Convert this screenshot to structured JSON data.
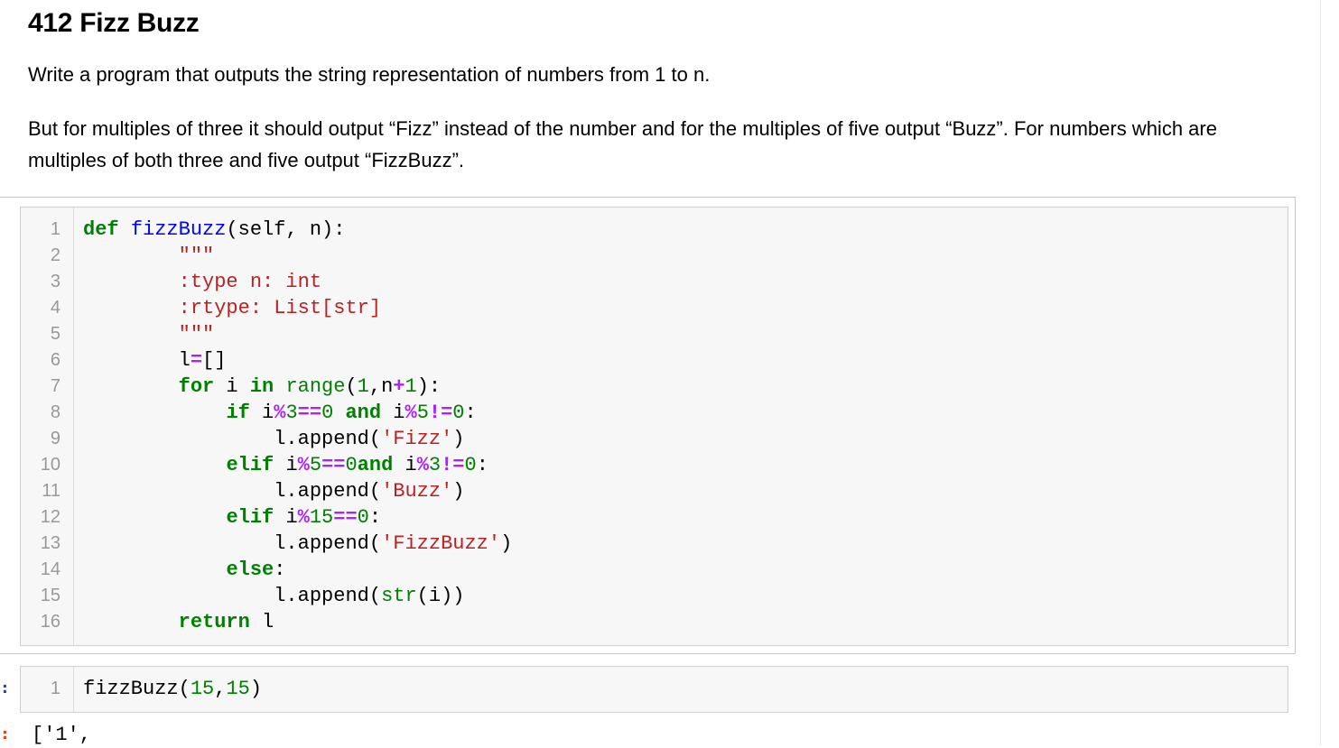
{
  "markdown": {
    "heading": "412 Fizz Buzz",
    "paragraph1": "Write a program that outputs the string representation of numbers from 1 to n.",
    "paragraph2": "But for multiples of three it should output “Fizz” instead of the number and for the multiples of five output “Buzz”. For numbers which are multiples of both three and five output “FizzBuzz”."
  },
  "prompts": {
    "cell1": ":",
    "cell2": ":",
    "output": ":"
  },
  "cell1": {
    "line_numbers": [
      "1",
      "2",
      "3",
      "4",
      "5",
      "6",
      "7",
      "8",
      "9",
      "10",
      "11",
      "12",
      "13",
      "14",
      "15",
      "16"
    ],
    "lines": [
      [
        {
          "t": "def ",
          "c": "kw"
        },
        {
          "t": "fizzBuzz",
          "c": "fn"
        },
        {
          "t": "(self, n):",
          "c": ""
        }
      ],
      [
        {
          "t": "        \"\"\"",
          "c": "str"
        }
      ],
      [
        {
          "t": "        :type n: int",
          "c": "str"
        }
      ],
      [
        {
          "t": "        :rtype: List[str]",
          "c": "str"
        }
      ],
      [
        {
          "t": "        \"\"\"",
          "c": "str"
        }
      ],
      [
        {
          "t": "        l",
          "c": ""
        },
        {
          "t": "=",
          "c": "op"
        },
        {
          "t": "[]",
          "c": ""
        }
      ],
      [
        {
          "t": "        ",
          "c": ""
        },
        {
          "t": "for",
          "c": "kw"
        },
        {
          "t": " i ",
          "c": ""
        },
        {
          "t": "in",
          "c": "kw"
        },
        {
          "t": " ",
          "c": ""
        },
        {
          "t": "range",
          "c": "bi"
        },
        {
          "t": "(",
          "c": ""
        },
        {
          "t": "1",
          "c": "num"
        },
        {
          "t": ",n",
          "c": ""
        },
        {
          "t": "+",
          "c": "op"
        },
        {
          "t": "1",
          "c": "num"
        },
        {
          "t": "):",
          "c": ""
        }
      ],
      [
        {
          "t": "            ",
          "c": ""
        },
        {
          "t": "if",
          "c": "kw"
        },
        {
          "t": " i",
          "c": ""
        },
        {
          "t": "%",
          "c": "op"
        },
        {
          "t": "3",
          "c": "num"
        },
        {
          "t": "==",
          "c": "op"
        },
        {
          "t": "0",
          "c": "num"
        },
        {
          "t": " ",
          "c": ""
        },
        {
          "t": "and",
          "c": "kw"
        },
        {
          "t": " i",
          "c": ""
        },
        {
          "t": "%",
          "c": "op"
        },
        {
          "t": "5",
          "c": "num"
        },
        {
          "t": "!=",
          "c": "op"
        },
        {
          "t": "0",
          "c": "num"
        },
        {
          "t": ":",
          "c": ""
        }
      ],
      [
        {
          "t": "                l.append(",
          "c": ""
        },
        {
          "t": "'Fizz'",
          "c": "str"
        },
        {
          "t": ")",
          "c": ""
        }
      ],
      [
        {
          "t": "            ",
          "c": ""
        },
        {
          "t": "elif",
          "c": "kw"
        },
        {
          "t": " i",
          "c": ""
        },
        {
          "t": "%",
          "c": "op"
        },
        {
          "t": "5",
          "c": "num"
        },
        {
          "t": "==",
          "c": "op"
        },
        {
          "t": "0",
          "c": "num"
        },
        {
          "t": "and",
          "c": "kw"
        },
        {
          "t": " i",
          "c": ""
        },
        {
          "t": "%",
          "c": "op"
        },
        {
          "t": "3",
          "c": "num"
        },
        {
          "t": "!=",
          "c": "op"
        },
        {
          "t": "0",
          "c": "num"
        },
        {
          "t": ":",
          "c": ""
        }
      ],
      [
        {
          "t": "                l.append(",
          "c": ""
        },
        {
          "t": "'Buzz'",
          "c": "str"
        },
        {
          "t": ")",
          "c": ""
        }
      ],
      [
        {
          "t": "            ",
          "c": ""
        },
        {
          "t": "elif",
          "c": "kw"
        },
        {
          "t": " i",
          "c": ""
        },
        {
          "t": "%",
          "c": "op"
        },
        {
          "t": "15",
          "c": "num"
        },
        {
          "t": "==",
          "c": "op"
        },
        {
          "t": "0",
          "c": "num"
        },
        {
          "t": ":",
          "c": ""
        }
      ],
      [
        {
          "t": "                l.append(",
          "c": ""
        },
        {
          "t": "'FizzBuzz'",
          "c": "str"
        },
        {
          "t": ")",
          "c": ""
        }
      ],
      [
        {
          "t": "            ",
          "c": ""
        },
        {
          "t": "else",
          "c": "kw"
        },
        {
          "t": ":",
          "c": ""
        }
      ],
      [
        {
          "t": "                l.append(",
          "c": ""
        },
        {
          "t": "str",
          "c": "bi"
        },
        {
          "t": "(i))",
          "c": ""
        }
      ],
      [
        {
          "t": "        ",
          "c": ""
        },
        {
          "t": "return",
          "c": "kw"
        },
        {
          "t": " l",
          "c": ""
        }
      ]
    ]
  },
  "cell2": {
    "line_numbers": [
      "1"
    ],
    "lines": [
      [
        {
          "t": "fizzBuzz(",
          "c": ""
        },
        {
          "t": "15",
          "c": "num"
        },
        {
          "t": ",",
          "c": ""
        },
        {
          "t": "15",
          "c": "num"
        },
        {
          "t": ")",
          "c": ""
        }
      ]
    ]
  },
  "output": {
    "text": "['1',"
  }
}
